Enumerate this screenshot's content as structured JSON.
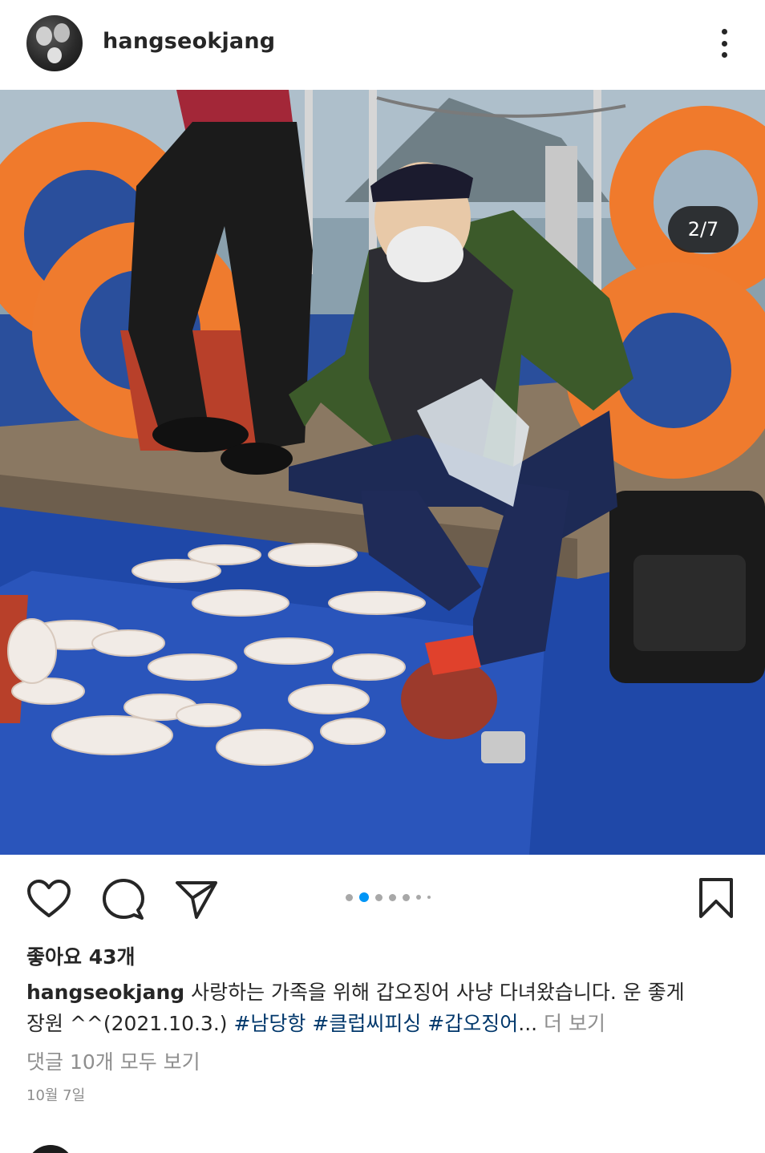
{
  "post": {
    "username": "hangseokjang",
    "image_counter": "2/7",
    "likes_text": "좋아요 43개",
    "caption": {
      "username": "hangseokjang",
      "text_line1": " 사랑하는 가족을 위해 갑오징어 사냥 다녀왔습니다. 운 좋게",
      "text_line2": "장원 ^^(2021.10.3.) ",
      "hashtags": [
        "#남당항",
        "#클럽씨피싱",
        "#갑오징어"
      ],
      "ellipsis": "...",
      "more_label": " 더 보기"
    },
    "comments_link": "댓글 10개 모두 보기",
    "date": "10월 7일"
  },
  "carousel": {
    "total": 7,
    "current_index": 2,
    "visible_dots": 7
  },
  "icons": {
    "like": "heart-icon",
    "comment": "comment-bubble-icon",
    "share": "paper-plane-icon",
    "save": "bookmark-icon",
    "more": "more-vertical-icon"
  },
  "colors": {
    "text": "#262626",
    "secondary": "#8e8e8e",
    "hashtag": "#00376b",
    "active_dot": "#0095f6"
  }
}
